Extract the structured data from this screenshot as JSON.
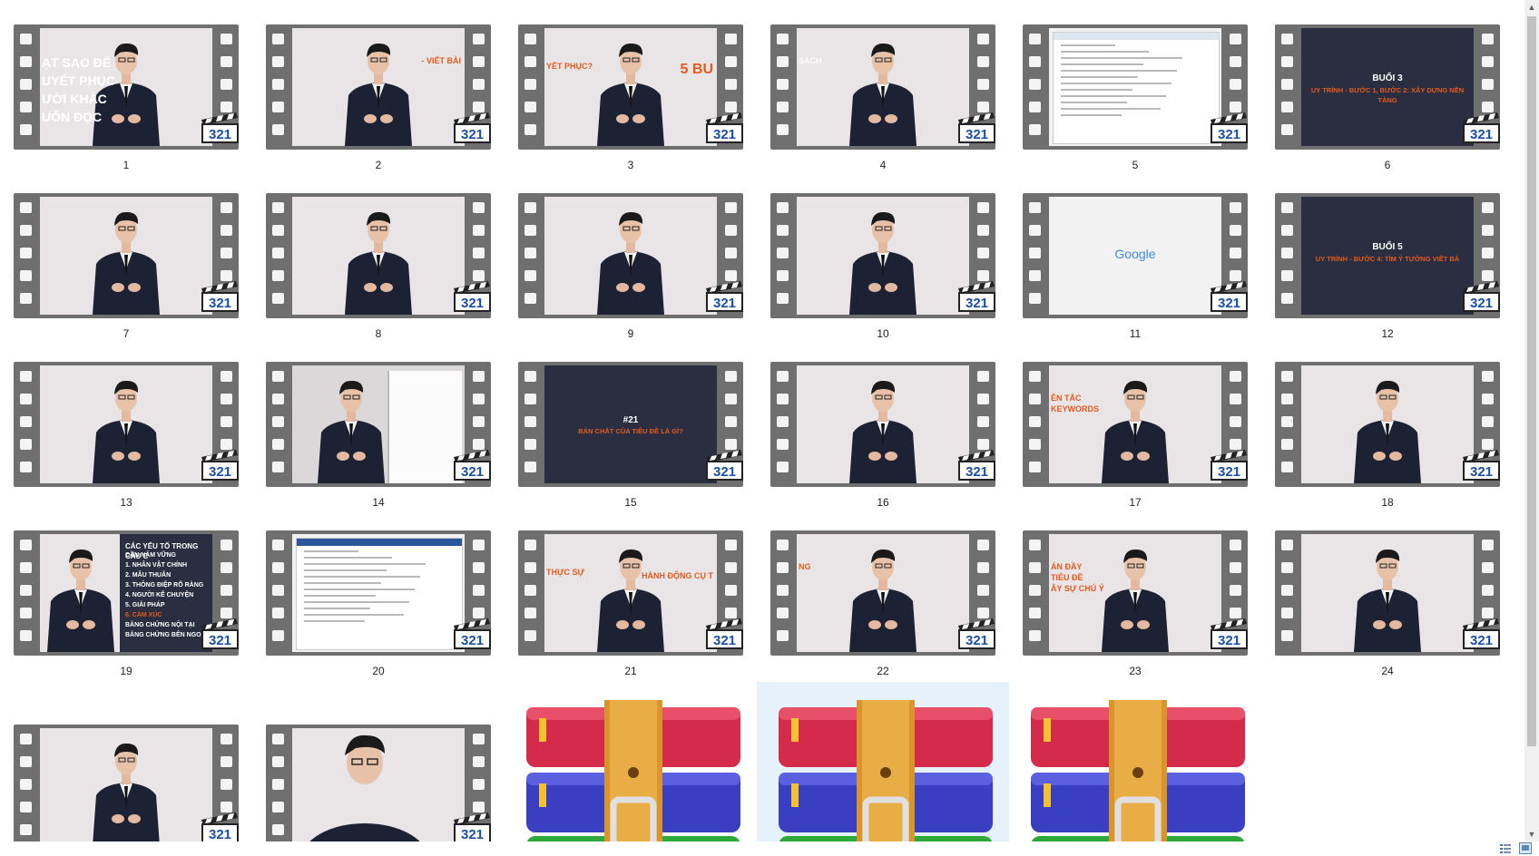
{
  "thumbnails": [
    {
      "label": "1",
      "type": "video",
      "scene": "speaker",
      "text": [
        "ẠT SAO ĐỂ",
        "UYẾT PHỤC",
        "ƯỜI KHÁC",
        "UỐN ĐỌC"
      ],
      "text_color": "#ffffff",
      "text_pos": "left-big"
    },
    {
      "label": "2",
      "type": "video",
      "scene": "speaker",
      "text": [
        "- VIẾT BÀI"
      ],
      "text_color": "#e35b1f",
      "text_pos": "right"
    },
    {
      "label": "3",
      "type": "video",
      "scene": "speaker",
      "text": [
        "YẾT PHỤC?",
        "5 BU"
      ],
      "text_color": "#e35b1f",
      "text_pos": "split"
    },
    {
      "label": "4",
      "type": "video",
      "scene": "speaker",
      "text": [
        "SÁCH"
      ],
      "text_color": "#ffffff",
      "text_pos": "left"
    },
    {
      "label": "5",
      "type": "screen",
      "scene": "document"
    },
    {
      "label": "6",
      "type": "video",
      "scene": "title",
      "title": "BUỔI 3",
      "text": [
        "UY TRÌNH - BƯỚC 1, BƯỚC 2: XÂY DỰNG NỀN TẢNG"
      ]
    },
    {
      "label": "7",
      "type": "video",
      "scene": "speaker"
    },
    {
      "label": "8",
      "type": "video",
      "scene": "speaker"
    },
    {
      "label": "9",
      "type": "video",
      "scene": "speaker"
    },
    {
      "label": "10",
      "type": "video",
      "scene": "speaker"
    },
    {
      "label": "11",
      "type": "screen",
      "scene": "google",
      "text": [
        "Google"
      ]
    },
    {
      "label": "12",
      "type": "video",
      "scene": "title",
      "title": "BUỔI 5",
      "text": [
        "UY TRÌNH - BƯỚC 4: TÌM Ý TƯỞNG VIẾT BÀ"
      ]
    },
    {
      "label": "13",
      "type": "video",
      "scene": "speaker"
    },
    {
      "label": "14",
      "type": "video",
      "scene": "whiteboard"
    },
    {
      "label": "15",
      "type": "video",
      "scene": "title-small",
      "title": "#21",
      "text": [
        "BẢN CHẤT CỦA TIÊU ĐỀ LÀ GÌ?"
      ]
    },
    {
      "label": "16",
      "type": "video",
      "scene": "speaker"
    },
    {
      "label": "17",
      "type": "video",
      "scene": "speaker",
      "text": [
        "ÊN TẮC",
        "KEYWORDS"
      ],
      "text_color": "#e35b1f",
      "text_pos": "left"
    },
    {
      "label": "18",
      "type": "video",
      "scene": "speaker"
    },
    {
      "label": "19",
      "type": "video",
      "scene": "list",
      "title": "CÁC YẾU TỐ TRONG CÂU C",
      "text": [
        "CẦN NẮM VỮNG",
        "1. NHÂN VẬT CHÍNH",
        "2. MÂU THUẪN",
        "3. THÔNG ĐIỆP RÕ RÀNG",
        "4. NGƯỜI KỂ CHUYỆN",
        "5. GIẢI PHÁP",
        "6. CẢM XÚC",
        "BẰNG CHỨNG NỘI TẠI",
        "BẰNG CHỨNG BÊN NGOÀI"
      ]
    },
    {
      "label": "20",
      "type": "screen",
      "scene": "document2"
    },
    {
      "label": "21",
      "type": "video",
      "scene": "speaker",
      "text": [
        "THỰC SỰ",
        "HÀNH ĐỘNG CỤ T"
      ],
      "text_color": "#e35b1f",
      "text_pos": "split"
    },
    {
      "label": "22",
      "type": "video",
      "scene": "speaker",
      "text": [
        "NG"
      ],
      "text_color": "#e35b1f",
      "text_pos": "left"
    },
    {
      "label": "23",
      "type": "video",
      "scene": "speaker",
      "text": [
        "ÁN ĐẦY",
        "TIÊU ĐỀ",
        "ÂY SỰ CHÚ Ý"
      ],
      "text_color": "#e35b1f",
      "text_pos": "left"
    },
    {
      "label": "24",
      "type": "video",
      "scene": "speaker"
    }
  ],
  "bottom_row": [
    {
      "type": "video",
      "scene": "speaker"
    },
    {
      "type": "video",
      "scene": "speaker-close"
    },
    {
      "type": "archive"
    },
    {
      "type": "archive",
      "selected": true
    },
    {
      "type": "archive"
    }
  ],
  "slate_text": "321",
  "scroll": {
    "up": "▲",
    "down": "▼"
  },
  "colors": {
    "film": "#6f6f6f",
    "slide_dark": "#2a2e40",
    "accent_orange": "#e35b1f",
    "selection": "#e5f1fb"
  }
}
